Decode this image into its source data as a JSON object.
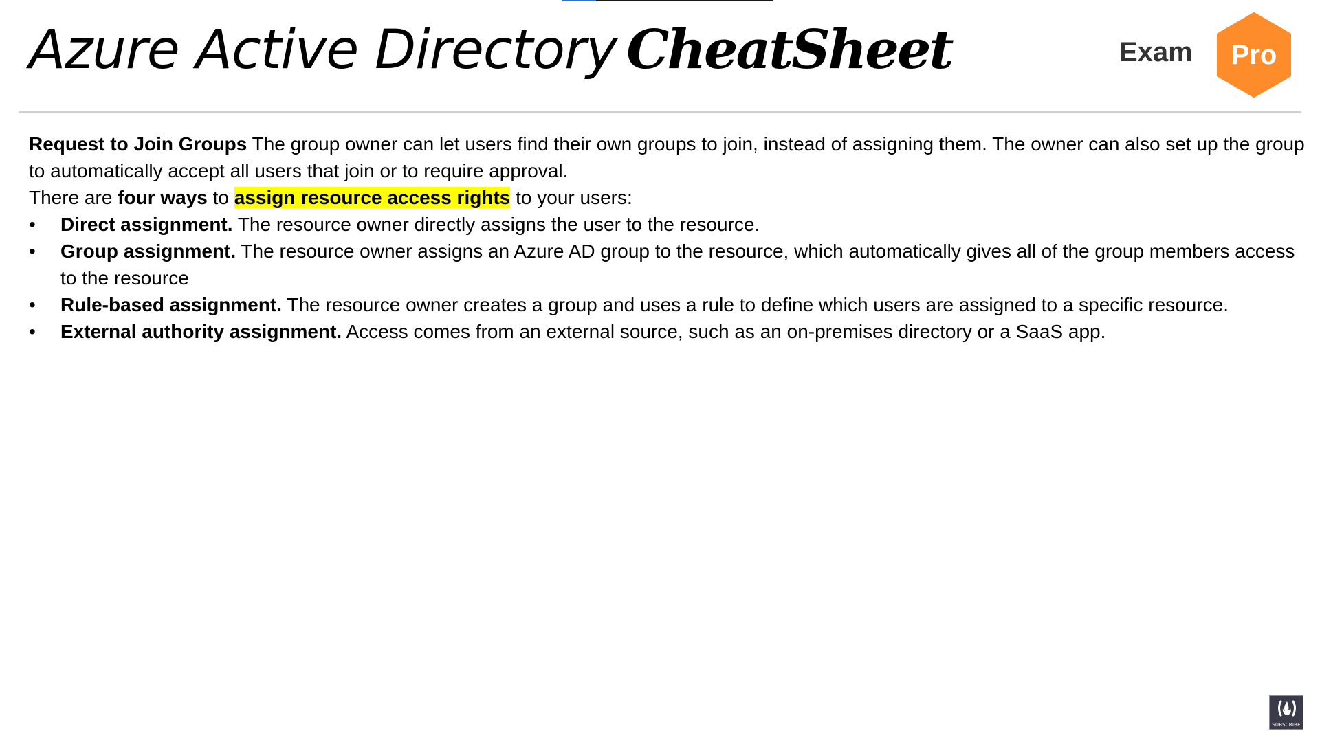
{
  "title": {
    "plain": "Azure Active Directory",
    "bold": "CheatSheet"
  },
  "logo": {
    "word": "Exam",
    "badge": "Pro",
    "badge_color": "#ff8c2b"
  },
  "paragraphs": {
    "join_groups_heading": "Request to Join Groups",
    "join_groups_text": " The group owner can let users find their own groups to join, instead of assigning them. The owner can also set up the group to automatically accept all users that join or to require approval.",
    "ways_prefix": "There are ",
    "ways_bold": "four ways",
    "ways_middle": " to ",
    "ways_highlight": "assign resource access rights",
    "ways_suffix": " to your users:"
  },
  "bullets": [
    {
      "term": "Direct assignment.",
      "text": " The resource owner directly assigns the user to the resource."
    },
    {
      "term": "Group assignment.",
      "text": " The resource owner assigns an Azure AD group to the resource, which automatically gives all of the group members access to the resource"
    },
    {
      "term": "Rule-based assignment.",
      "text": " The resource owner creates a group and uses a rule to define which users are assigned to a specific resource."
    },
    {
      "term": "External authority assignment.",
      "text": " Access comes from an external source, such as an on-premises directory or a SaaS app."
    }
  ],
  "bullet_glyph": "•",
  "subscribe": {
    "label": "SUBSCRIBE",
    "icon": "freecodecamp-flame-icon"
  },
  "colors": {
    "highlight": "#ffff00",
    "progress": "#2f6fd0"
  },
  "progress": {
    "fraction": 0.16
  }
}
